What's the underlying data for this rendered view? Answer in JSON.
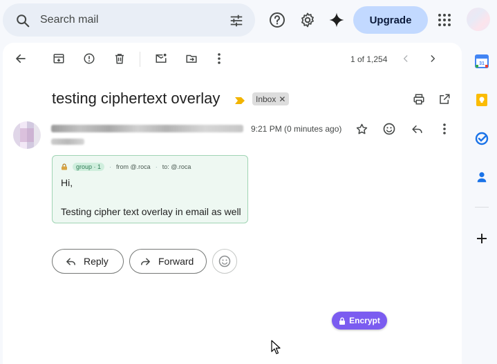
{
  "search": {
    "placeholder": "Search mail"
  },
  "header": {
    "upgrade_label": "Upgrade"
  },
  "toolbar": {
    "pager_text": "1 of 1,254"
  },
  "message": {
    "subject": "testing ciphertext overlay",
    "label_chip": "Inbox",
    "time": "9:21 PM (0 minutes ago)",
    "meta": {
      "group": "group · 1",
      "from": "from @.roca",
      "to": "to: @.roca"
    },
    "body_line1": "Hi,",
    "body_line2": "Testing cipher text overlay in email as well"
  },
  "actions": {
    "reply_label": "Reply",
    "forward_label": "Forward"
  },
  "encrypt": {
    "label": "Encrypt"
  },
  "colors": {
    "encrypt_bg": "#7b5cf0",
    "upgrade_bg": "#c2d9ff",
    "bubble_border": "#9fd4b3",
    "important_marker": "#f2b400"
  },
  "icons": [
    "search-icon",
    "tune-icon",
    "help-icon",
    "gear-icon",
    "gemini-icon",
    "apps-icon",
    "back-icon",
    "archive-icon",
    "report-spam-icon",
    "delete-icon",
    "mark-unread-icon",
    "move-to-icon",
    "more-icon",
    "prev-icon",
    "next-icon",
    "print-icon",
    "open-new-window-icon",
    "star-icon",
    "emoji-icon",
    "reply-icon",
    "calendar-icon",
    "keep-icon",
    "tasks-icon",
    "contacts-icon",
    "add-icon",
    "lock-icon"
  ]
}
